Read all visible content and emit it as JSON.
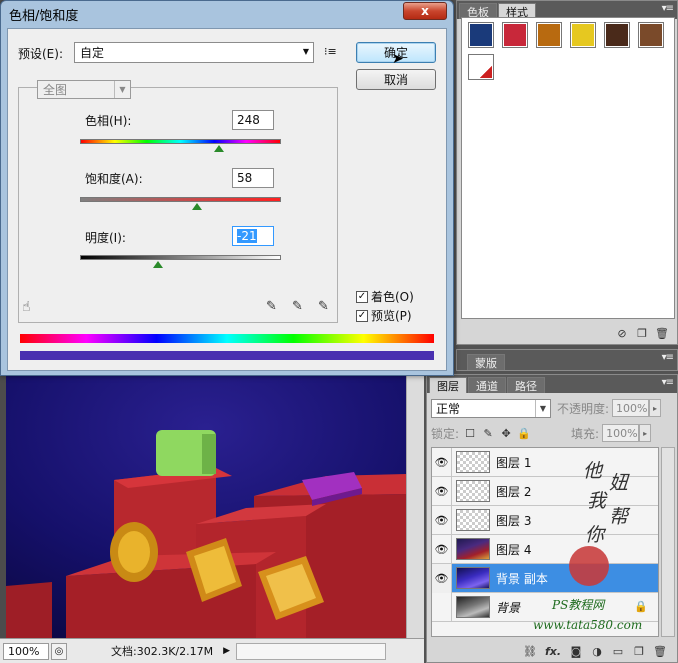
{
  "dialog": {
    "title": "色相/饱和度",
    "close_label": "x",
    "preset_label": "预设(E):",
    "preset_value": "自定",
    "ok_label": "确定",
    "cancel_label": "取消",
    "range_value": "全图",
    "hue_label": "色相(H):",
    "hue_value": "248",
    "saturation_label": "饱和度(A):",
    "saturation_value": "58",
    "lightness_label": "明度(I):",
    "lightness_value": "-21",
    "colorize_label": "着色(O)",
    "colorize_checked": true,
    "preview_label": "预览(P)",
    "preview_checked": true,
    "hue_slider_fraction": 0.69,
    "saturation_slider_fraction": 0.58,
    "lightness_slider_fraction": 0.39
  },
  "styles_panel": {
    "tabs": [
      "色板",
      "样式"
    ],
    "active_tab": "样式",
    "swatches": [
      {
        "name": "star-style-swatch",
        "color": "#1a3a7a"
      },
      {
        "name": "stripes-style-swatch",
        "color": "#c8283a"
      },
      {
        "name": "gold-burst-style-swatch",
        "color": "#b86a10"
      },
      {
        "name": "yellow-glow-style-swatch",
        "color": "#e6c820"
      },
      {
        "name": "dark-bevel-style-swatch",
        "color": "#4a2a1a"
      },
      {
        "name": "bronze-style-swatch",
        "color": "#7a4a2a"
      },
      {
        "name": "red-corner-style-swatch",
        "color": "#ffffff"
      }
    ]
  },
  "mask_panel": {
    "tab": "蒙版"
  },
  "layers_panel": {
    "tabs": [
      "图层",
      "通道",
      "路径"
    ],
    "active_tab": "图层",
    "blend_mode": "正常",
    "opacity_label": "不透明度:",
    "opacity_value": "100%",
    "lock_label": "锁定:",
    "fill_label": "填充:",
    "fill_value": "100%",
    "layers": [
      {
        "name": "图层 1",
        "visible": true,
        "selected": false
      },
      {
        "name": "图层 2",
        "visible": true,
        "selected": false
      },
      {
        "name": "图层 3",
        "visible": true,
        "selected": false
      },
      {
        "name": "图层 4",
        "visible": true,
        "selected": false
      },
      {
        "name": "背景 副本",
        "visible": true,
        "selected": true
      },
      {
        "name": "背景",
        "visible": false,
        "selected": false
      }
    ],
    "footer_fx": "fx."
  },
  "status_bar": {
    "zoom": "100%",
    "doc_info": "文档:302.3K/2.17M"
  },
  "watermark": {
    "chars": [
      "他",
      "妞",
      "我",
      "帮",
      "你"
    ],
    "brand": "PS教程网",
    "url": "www.tata580.com"
  },
  "colors": {
    "selection_blue": "#3d8ee3",
    "dialog_title_blue": "#a9c4de",
    "close_red": "#c9452d"
  }
}
